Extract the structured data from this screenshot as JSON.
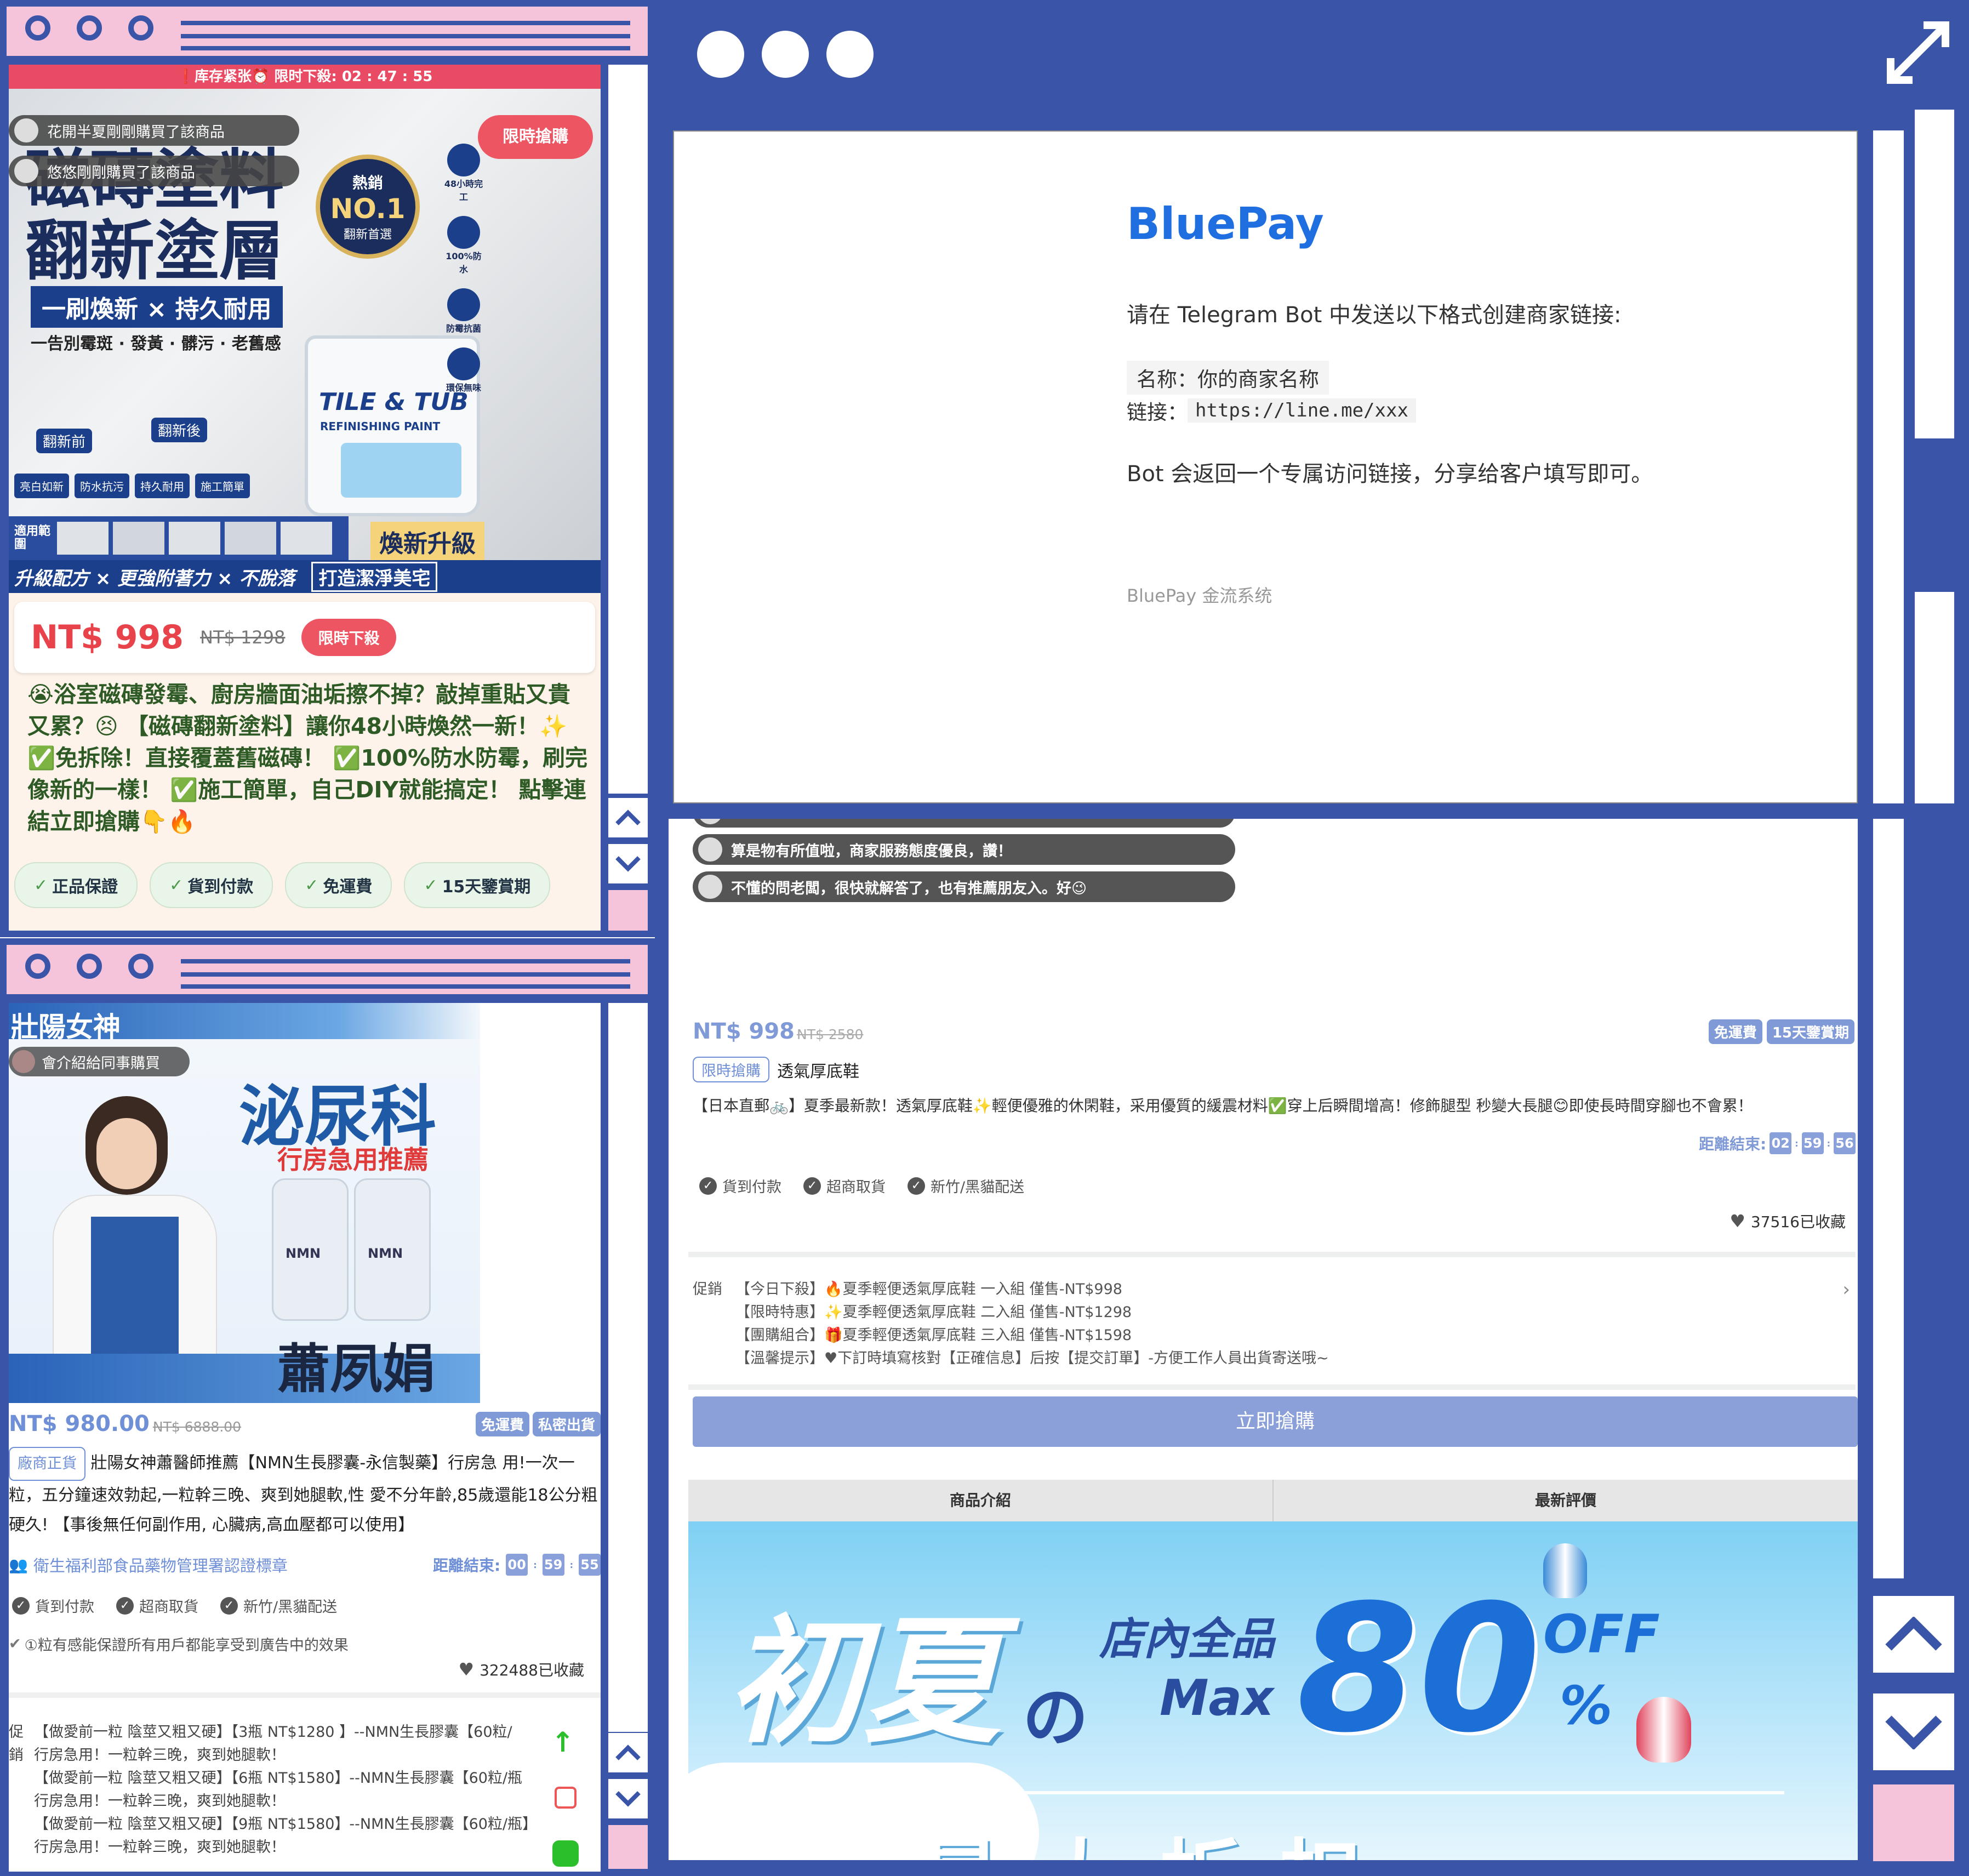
{
  "colors": {
    "frame": "#3a55a8",
    "pink": "#f6c4da",
    "accent": "#7f9ad6",
    "bluepay": "#1f6fe0",
    "price_red": "#e8424a"
  },
  "bluepay": {
    "title": "BluePay",
    "instruction": "请在 Telegram Bot 中发送以下格式创建商家链接:",
    "name_line": "名称：你的商家名称",
    "link_label": "链接：",
    "link_value": "https://line.me/xxx",
    "result": "Bot 会返回一个专属访问链接，分享给客户填写即可。",
    "footer": "BluePay 金流系统"
  },
  "tile": {
    "top_banner": "❗库存紧张⏰ 限时下殺: 02 : 47 : 55",
    "buyer_1": "花開半夏剛剛購買了該商品",
    "buyer_2": "悠悠剛剛購買了該商品",
    "flash_button": "限時搶購",
    "img_title_1": "磁磚塗料",
    "img_title_2": "翻新塗層",
    "img_slogan": "一刷煥新 × 持久耐用",
    "img_sub": "一告別霉斑 · 發黃 · 髒污 · 老舊感",
    "img_badge_top": "熱銷",
    "img_badge_no": "NO.1",
    "img_badge_bottom": "翻新首選",
    "img_before": "翻新前",
    "img_after": "翻新後",
    "img_brand": "TILE & TUB",
    "img_brand_sub": "REFINISHING PAINT",
    "img_upgrade": "煥新升級",
    "img_clean": "打造潔淨美宅",
    "img_bottom": "升級配方 × 更強附著力 × 不脫落",
    "img_scope": "適用範圍",
    "img_icons": [
      "48小時完工",
      "100%防水",
      "防霉抗菌",
      "環保無味"
    ],
    "img_features": [
      "亮白如新",
      "防水抗污",
      "持久耐用",
      "施工簡單"
    ],
    "price": "NT$ 998",
    "orig_price": "NT$ 1298",
    "sale_tag": "限時下殺",
    "description": "😭浴室磁磚發霉、廚房牆面油垢擦不掉？敲掉重貼又貴又累？😣 【磁磚翻新塗料】讓你48小時煥然一新！✨ ✅免拆除！直接覆蓋舊磁磚！ ✅100%防水防霉，刷完像新的一樣！ ✅施工簡單，自己DIY就能搞定！ 點擊連結立即搶購👇🔥",
    "pills": [
      "正品保證",
      "貨到付款",
      "免運費",
      "15天鑒賞期"
    ]
  },
  "nmn": {
    "banner_title": "壯陽女神",
    "share_text": "會介紹給同事購買",
    "img_heading": "泌尿科",
    "img_subheading": "行房急用推薦",
    "img_doctor": "蕭夙娟",
    "bottle_label": "NMN",
    "price": "NT$ 980.00",
    "orig_price": "NT$ 6888.00",
    "badges": [
      "免運費",
      "私密出貨"
    ],
    "tag": "廠商正貨",
    "description": "壯陽女神蕭醫師推薦【NMN生長膠囊-永信製藥】行房急 用!一次一粒，五分鐘速效勃起,一粒幹三晚、爽到她腿軟,性 愛不分年齡,85歲還能18公分粗硬久! 【事後無任何副作用, 心臟病,高血壓都可以使用】",
    "cert": "衛生福利部食品藥物管理署認證標章",
    "countdown_label": "距離結束:",
    "countdown": [
      "00",
      "59",
      "55"
    ],
    "services": [
      "貨到付款",
      "超商取貨",
      "新竹/黑貓配送"
    ],
    "effect": "①粒有感能保證所有用戶都能享受到廣告中的效果",
    "favorites": "322488已收藏",
    "promo_label_1": "促",
    "promo_label_2": "銷",
    "promos": [
      "【做愛前一粒 陰莖又粗又硬】【3瓶 NT$1280 】--NMN生長膠囊【60粒/",
      "行房急用！一粒幹三晚，爽到她腿軟！",
      "【做愛前一粒 陰莖又粗又硬】【6瓶 NT$1580】--NMN生長膠囊【60粒/瓶",
      "行房急用！一粒幹三晚，爽到她腿軟！",
      "【做愛前一粒 陰莖又粗又硬】【9瓶 NT$1580】--NMN生長膠囊【60粒/瓶】",
      "行房急用！一粒幹三晚，爽到她腿軟！"
    ]
  },
  "shoe": {
    "review_1": "算是物有所值啦，商家服務態度優良，讚！",
    "review_2": "不懂的問老闆，很快就解答了，也有推薦朋友入。好😉",
    "price": "NT$ 998",
    "orig_price": "NT$ 2580",
    "badges": [
      "免運費",
      "15天鑒賞期"
    ],
    "tag": "限時搶購",
    "name": "透氣厚底鞋",
    "description": "【日本直郵🚲】夏季最新款！透氣厚底鞋✨輕便優雅的休閑鞋，采用優質的緩震材料✅穿上后瞬間增高！修飾腿型 秒變大長腿😊即使長時間穿腳也不會累！",
    "countdown_label": "距離結束:",
    "countdown": [
      "02",
      "59",
      "56"
    ],
    "services": [
      "貨到付款",
      "超商取貨",
      "新竹/黑貓配送"
    ],
    "favorites": "37516已收藏",
    "promo_label": "促銷",
    "promos": [
      "【今日下殺】🔥夏季輕便透氣厚底鞋 一入組 僅售-NT$998",
      "【限時特惠】✨夏季輕便透氣厚底鞋 二入組 僅售-NT$1298",
      "【團購組合】🎁夏季輕便透氣厚底鞋 三入組 僅售-NT$1598",
      "【溫馨提示】♥下訂時填寫核對【正確信息】后按【提交訂單】-方便工作人員出貨寄送哦~"
    ],
    "buy_button": "立即搶購",
    "tabs": [
      "商品介紹",
      "最新評價"
    ],
    "banner_big": "初夏",
    "banner_no": "の",
    "banner_store": "店內全品",
    "banner_max": "Max",
    "banner_80": "80",
    "banner_off": "OFF",
    "banner_pct": "%",
    "banner_bottom": "最大折扣"
  }
}
